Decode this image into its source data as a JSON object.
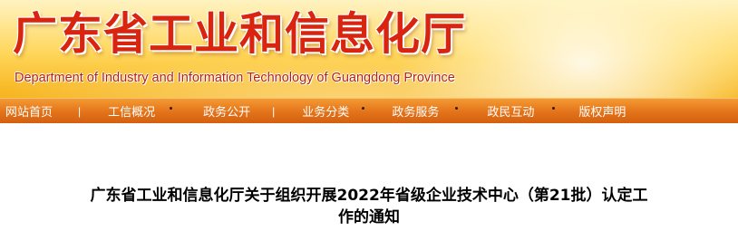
{
  "header": {
    "site_title": "广东省工业和信息化厅",
    "site_subtitle": "Department of Industry and Information Technology of Guangdong Province"
  },
  "nav": {
    "items": [
      {
        "label": "网站首页"
      },
      {
        "label": "工信概况"
      },
      {
        "label": "政务公开"
      },
      {
        "label": "业务分类"
      },
      {
        "label": "政务服务"
      },
      {
        "label": "政民互动"
      },
      {
        "label": "版权声明"
      }
    ],
    "separator": "|"
  },
  "article": {
    "title_line1": "广东省工业和信息化厅关于组织开展2022年省级企业技术中心（第21批）认定工",
    "title_line2": "作的通知"
  },
  "colors": {
    "title_red": "#d9240f",
    "nav_orange": "#e3731a",
    "banner_yellow": "#ffd65a"
  }
}
